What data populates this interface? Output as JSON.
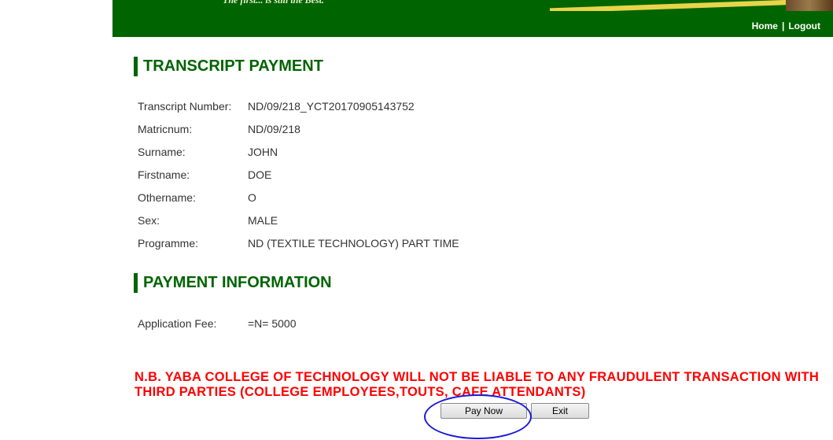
{
  "header": {
    "tagline": "The first... is still the Best.",
    "nav": {
      "home": "Home",
      "separator": "|",
      "logout": "Logout"
    }
  },
  "transcript_section": {
    "title": "TRANSCRIPT PAYMENT",
    "fields": [
      {
        "label": "Transcript Number:",
        "value": "ND/09/218_YCT20170905143752"
      },
      {
        "label": "Matricnum:",
        "value": "ND/09/218"
      },
      {
        "label": "Surname:",
        "value": "JOHN"
      },
      {
        "label": "Firstname:",
        "value": "DOE"
      },
      {
        "label": "Othername:",
        "value": "O"
      },
      {
        "label": "Sex:",
        "value": "MALE"
      },
      {
        "label": "Programme:",
        "value": "ND (TEXTILE TECHNOLOGY) PART TIME"
      }
    ]
  },
  "payment_section": {
    "title": "PAYMENT INFORMATION",
    "fields": [
      {
        "label": "Application Fee:",
        "value": "=N= 5000"
      }
    ]
  },
  "warning": "N.B. YABA COLLEGE OF TECHNOLOGY WILL NOT BE LIABLE TO ANY FRAUDULENT TRANSACTION WITH THIRD PARTIES (COLLEGE EMPLOYEES,TOUTS, CAFE ATTENDANTS)",
  "buttons": {
    "pay_now": "Pay Now",
    "exit": "Exit"
  },
  "colors": {
    "header_green": "#006400",
    "title_green": "#006400",
    "warning_red": "#ff0000",
    "annotation_blue": "#1a1ad8"
  }
}
